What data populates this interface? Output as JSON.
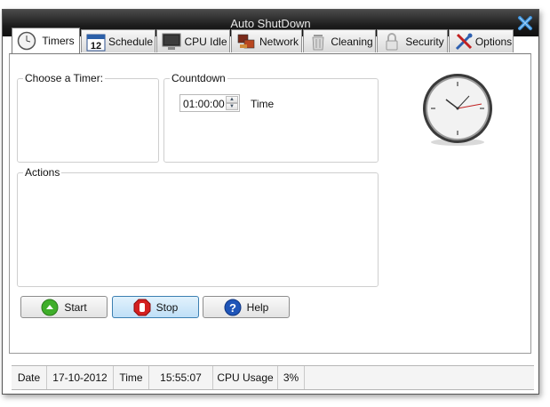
{
  "window": {
    "title": "Auto ShutDown"
  },
  "tabs": [
    {
      "label": "Timers",
      "icon": "clock-icon"
    },
    {
      "label": "Schedule",
      "icon": "calendar-icon",
      "calendar_day": "12"
    },
    {
      "label": "CPU Idle",
      "icon": "monitor-icon"
    },
    {
      "label": "Network",
      "icon": "network-icon"
    },
    {
      "label": "Cleaning",
      "icon": "trash-icon"
    },
    {
      "label": "Security",
      "icon": "lock-icon"
    },
    {
      "label": "Options",
      "icon": "tools-icon"
    }
  ],
  "timers": {
    "choose_label": "Choose a Timer:",
    "countdown_label": "Countdown",
    "countdown_value": "01:00:00",
    "time_label": "Time",
    "actions_label": "Actions"
  },
  "buttons": {
    "start": "Start",
    "stop": "Stop",
    "help": "Help"
  },
  "status": {
    "date_label": "Date",
    "date_value": "17-10-2012",
    "time_label": "Time",
    "time_value": "15:55:07",
    "cpu_label": "CPU Usage",
    "cpu_value": "3%"
  },
  "colors": {
    "titlebar": "#1c1c1c",
    "close": "#3b8fd8",
    "stop_button": "#bfdff7"
  }
}
